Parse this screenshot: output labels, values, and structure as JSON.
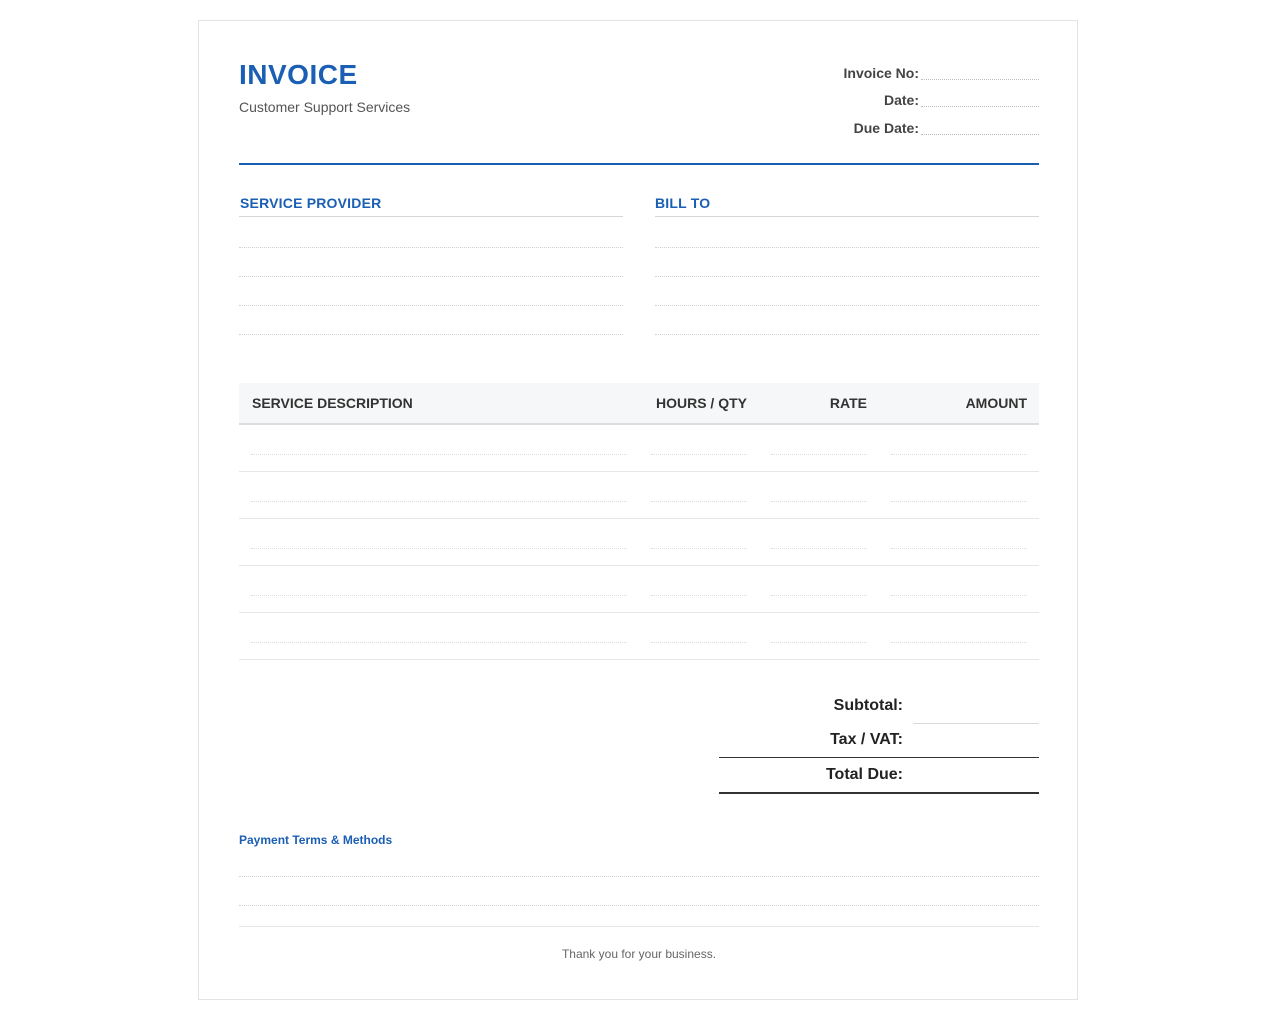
{
  "header": {
    "title": "INVOICE",
    "subtitle": "Customer Support Services",
    "meta": {
      "invoice_no_label": "Invoice No:",
      "date_label": "Date:",
      "due_date_label": "Due Date:"
    }
  },
  "parties": {
    "provider_heading": "SERVICE PROVIDER",
    "bill_to_heading": "BILL TO"
  },
  "table": {
    "headers": [
      "SERVICE DESCRIPTION",
      "HOURS / QTY",
      "RATE",
      "AMOUNT"
    ]
  },
  "totals": {
    "subtotal_label": "Subtotal:",
    "tax_label": "Tax / VAT:",
    "total_label": "Total Due:"
  },
  "payment": {
    "heading": "Payment Terms & Methods"
  },
  "footer": {
    "thanks": "Thank you for your business."
  },
  "colors": {
    "accent": "#1a5fb4"
  }
}
